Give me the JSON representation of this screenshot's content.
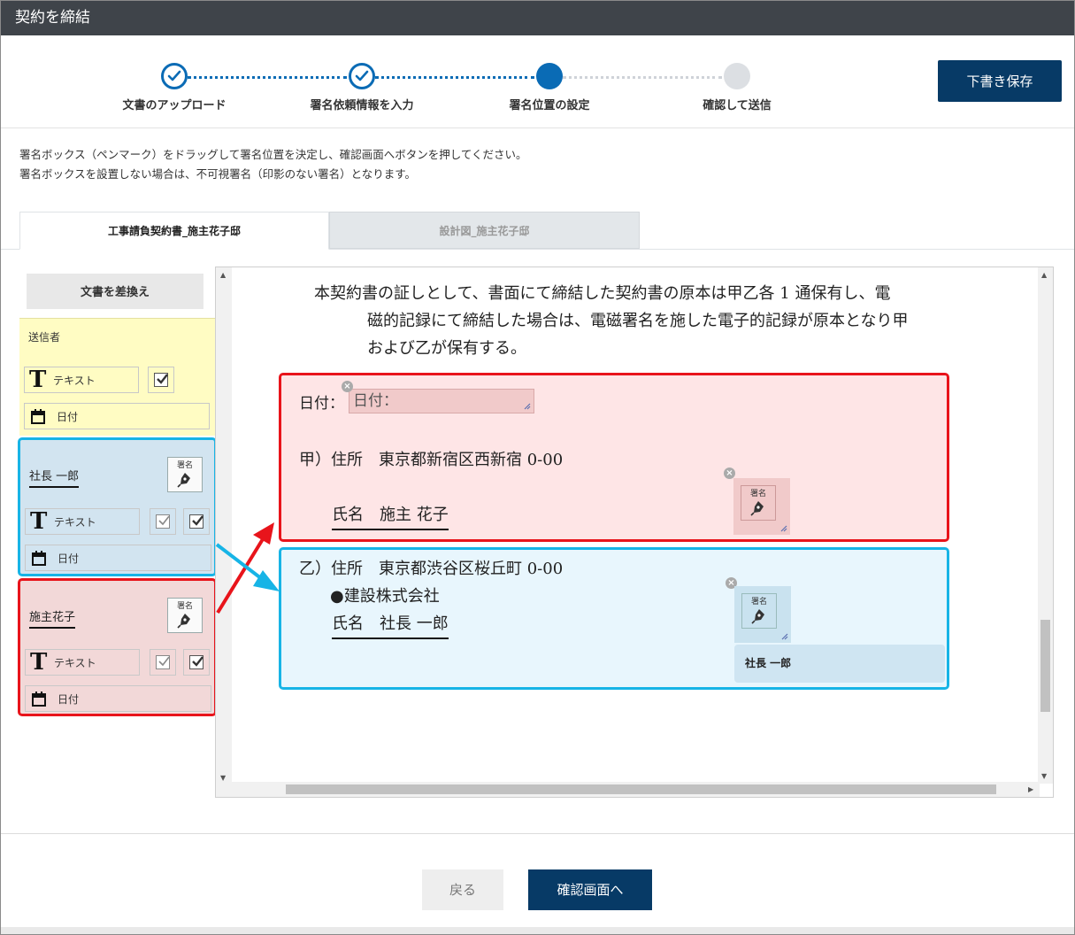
{
  "window": {
    "title": "契約を締結"
  },
  "steps": [
    {
      "label": "文書のアップロード",
      "state": "done"
    },
    {
      "label": "署名依頼情報を入力",
      "state": "done"
    },
    {
      "label": "署名位置の設定",
      "state": "current"
    },
    {
      "label": "確認して送信",
      "state": "future"
    }
  ],
  "toolbar": {
    "save_draft_label": "下書き保存"
  },
  "instructions": {
    "line1": "署名ボックス（ペンマーク）をドラッグして署名位置を決定し、確認画面へボタンを押してください。",
    "line2": "署名ボックスを設置しない場合は、不可視署名（印影のない署名）となります。"
  },
  "tabs": [
    {
      "label": "工事請負契約書_施主花子邸",
      "active": true
    },
    {
      "label": "設計図_施主花子邸",
      "active": false
    }
  ],
  "left_panel": {
    "replace_label": "文書を差換え",
    "sender": {
      "title": "送信者",
      "text_label": "テキスト",
      "date_label": "日付"
    },
    "signer1": {
      "name": "社長 一郎",
      "seal_label": "署名",
      "text_label": "テキスト",
      "date_label": "日付"
    },
    "signer2": {
      "name": "施主花子",
      "seal_label": "署名",
      "text_label": "テキスト",
      "date_label": "日付"
    }
  },
  "document": {
    "para_line1": "本契約書の証しとして、書面にて締結した契約書の原本は甲乙各 1 通保有し、電",
    "para_line2": "磁的記録にて締結した場合は、電磁署名を施した電子的記録が原本となり甲",
    "para_line3": "および乙が保有する。",
    "date_label": "日付：",
    "date_field_value": "日付：",
    "party_a_address": "甲）住所　東京都新宿区西新宿 0-00",
    "party_a_name": "氏名　施主 花子",
    "party_b_address": "乙）住所　東京都渋谷区桜丘町 0-00",
    "party_b_company": "●建設株式会社",
    "party_b_name": "氏名　社長 一郎",
    "seal_label": "署名",
    "tooltip_name": "社長 一郎",
    "remove_glyph": "×"
  },
  "footer": {
    "back_label": "戻る",
    "confirm_label": "確認画面へ"
  },
  "colors": {
    "primary": "#073a66",
    "step_blue": "#0a6bb5",
    "sender_bg": "#fffcc3",
    "signer1_border": "#17b4e6",
    "signer2_border": "#e8141b"
  }
}
